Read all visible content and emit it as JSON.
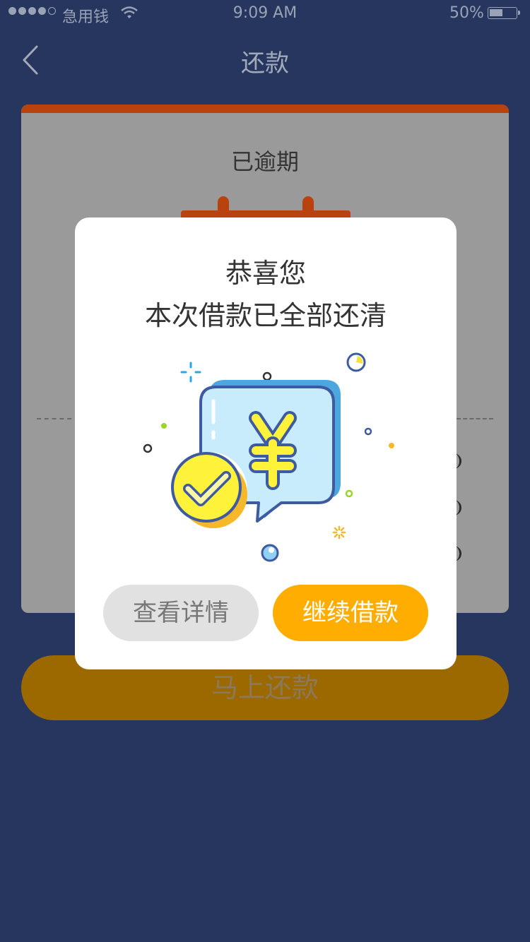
{
  "status_bar": {
    "carrier": "急用钱",
    "time": "9:09 AM",
    "battery": "50%",
    "battery_level": 0.5,
    "signal_bars": 4
  },
  "nav": {
    "title": "还款",
    "back_icon": "chevron-left-icon"
  },
  "card": {
    "status": "已逾期",
    "accent_color": "#b8430e"
  },
  "repay_button": {
    "label": "马上还款"
  },
  "dialog": {
    "line1": "恭喜您",
    "line2": "本次借款已全部还清",
    "illustration": "yuan-chat-bubble-with-check-coin",
    "secondary_button": "查看详情",
    "primary_button": "继续借款",
    "primary_color": "#ffad00"
  }
}
